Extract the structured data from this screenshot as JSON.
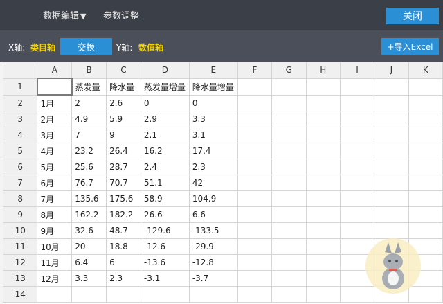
{
  "topbar": {
    "menu_data_edit": "数据编辑",
    "menu_params": "参数调整",
    "close_label": "关闭"
  },
  "axisbar": {
    "x_label": "X轴:",
    "x_value": "类目轴",
    "swap_label": "交换",
    "y_label": "Y轴:",
    "y_value": "数值轴",
    "import_label": "+导入Excel"
  },
  "sheet": {
    "columns": [
      "A",
      "B",
      "C",
      "D",
      "E",
      "F",
      "G",
      "H",
      "I",
      "J",
      "K"
    ],
    "rows": [
      [
        "",
        "蒸发量",
        "降水量",
        "蒸发量增量",
        "降水量增量"
      ],
      [
        "1月",
        "2",
        "2.6",
        "0",
        "0"
      ],
      [
        "2月",
        "4.9",
        "5.9",
        "2.9",
        "3.3"
      ],
      [
        "3月",
        "7",
        "9",
        "2.1",
        "3.1"
      ],
      [
        "4月",
        "23.2",
        "26.4",
        "16.2",
        "17.4"
      ],
      [
        "5月",
        "25.6",
        "28.7",
        "2.4",
        "2.3"
      ],
      [
        "6月",
        "76.7",
        "70.7",
        "51.1",
        "42"
      ],
      [
        "7月",
        "135.6",
        "175.6",
        "58.9",
        "104.9"
      ],
      [
        "8月",
        "162.2",
        "182.2",
        "26.6",
        "6.6"
      ],
      [
        "9月",
        "32.6",
        "48.7",
        "-129.6",
        "-133.5"
      ],
      [
        "10月",
        "20",
        "18.8",
        "-12.6",
        "-29.9"
      ],
      [
        "11月",
        "6.4",
        "6",
        "-13.6",
        "-12.8"
      ],
      [
        "12月",
        "3.3",
        "2.3",
        "-3.1",
        "-3.7"
      ],
      [
        "",
        "",
        "",
        "",
        ""
      ]
    ]
  }
}
